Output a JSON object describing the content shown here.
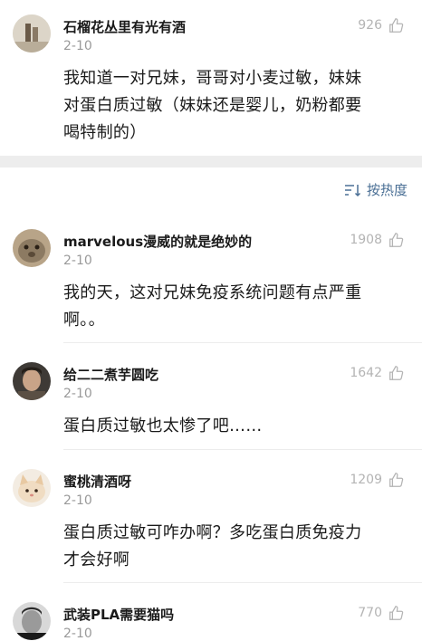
{
  "pinned": {
    "username": "石榴花丛里有光有酒",
    "date": "2-10",
    "likes": "926",
    "content_lines": [
      "我知道一对兄妹，哥哥对小麦过敏，妹妹",
      "对蛋白质过敏（妹妹还是婴儿，奶粉都要",
      "喝特制的）"
    ]
  },
  "sort": {
    "label": "按热度",
    "icon": "sort-icon"
  },
  "comments": [
    {
      "username": "marvelous漫威的就是绝妙的",
      "date": "2-10",
      "likes": "1908",
      "content_lines": [
        "我的天，这对兄妹免疫系统问题有点严重",
        "啊。。"
      ]
    },
    {
      "username": "给二二煮芋圆吃",
      "date": "2-10",
      "likes": "1642",
      "content_lines": [
        "蛋白质过敏也太惨了吧……"
      ]
    },
    {
      "username": "蜜桃清酒呀",
      "date": "2-10",
      "likes": "1209",
      "content_lines": [
        "蛋白质过敏可咋办啊？多吃蛋白质免疫力",
        "才会好啊"
      ]
    },
    {
      "username": "武装PLA需要猫吗",
      "date": "2-10",
      "likes": "770",
      "content_lines": []
    }
  ],
  "colors": {
    "accent": "#4a6f95",
    "muted": "#9a9a9a",
    "like": "#b4b4b4"
  }
}
